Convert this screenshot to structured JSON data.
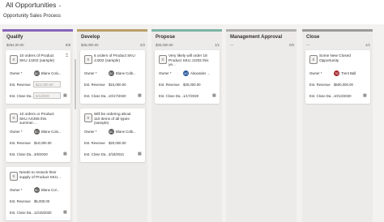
{
  "header": {
    "view_title": "All Opportunities",
    "process_title": "Opportunity Sales Process"
  },
  "icons": {
    "dropdown": "chevron-down-icon",
    "record": "document-icon",
    "lock": "lock-icon",
    "calendar": "calendar-icon"
  },
  "colors": {
    "qualify": "#8764b8",
    "develop": "#b9a06b",
    "propose": "#7fb4a5",
    "management_approval": "#b0b0b0",
    "close": "#9b9b9b"
  },
  "field_labels": {
    "owner": "Owner *",
    "est_revenue": "Est. Revenue",
    "est_close_date": "Est. Close Da..."
  },
  "columns": [
    {
      "name": "Qualify",
      "amount": "$254,00.00",
      "count": "8/8",
      "cards": [
        {
          "title": "10 orders of Product SKU JJ202 (sample)",
          "owner_initials": "BC",
          "owner": "Blane Colo...",
          "revenue": "$22,000.00",
          "close_date": "5/1/2020"
        },
        {
          "title": "10 orders or Product SKU AX305 this summer....",
          "owner_initials": "BC",
          "owner": "Blane Colo...",
          "revenue": "$10,000.00",
          "close_date": "3/6/2020"
        },
        {
          "title": "Needs to restock their supply of Product SKU...",
          "owner_initials": "BC",
          "owner": "Blane Col...",
          "revenue": "$5,000.00",
          "close_date": "12/15/2020"
        }
      ]
    },
    {
      "name": "Develop",
      "amount": "$35,000.00",
      "count": "2/2",
      "cards": [
        {
          "title": "6 orders of Product SKU JJ202 (sample)",
          "owner_initials": "BC",
          "owner": "Blane Colb...",
          "revenue": "$15,000.00",
          "close_date": "10/17/2020"
        },
        {
          "title": "Will be ordering about 110 items of all types (sample)",
          "owner_initials": "BC",
          "owner": "Blane Colb...",
          "revenue": "$20,000.00",
          "close_date": "3/18/2021"
        }
      ]
    },
    {
      "name": "Propose",
      "amount": "$30,000.00",
      "count": "1/1",
      "cards": [
        {
          "title": "Very likely will order 18 Product SKU JJ202 this ye...",
          "owner_initials": "AS",
          "owner": "Alexander ...",
          "revenue": "$30,000.00",
          "close_date": "1/17/2020"
        }
      ]
    },
    {
      "name": "Management Approval",
      "amount": "---",
      "count": "0/0",
      "cards": []
    },
    {
      "name": "Close",
      "amount": "---",
      "count": "1/1",
      "cards": [
        {
          "title": "Some New Closed Opportunity",
          "owner_initials": "TB",
          "owner": "Trent Ball",
          "revenue": "$500,000.00",
          "close_date": "10/13/2020"
        }
      ]
    }
  ]
}
